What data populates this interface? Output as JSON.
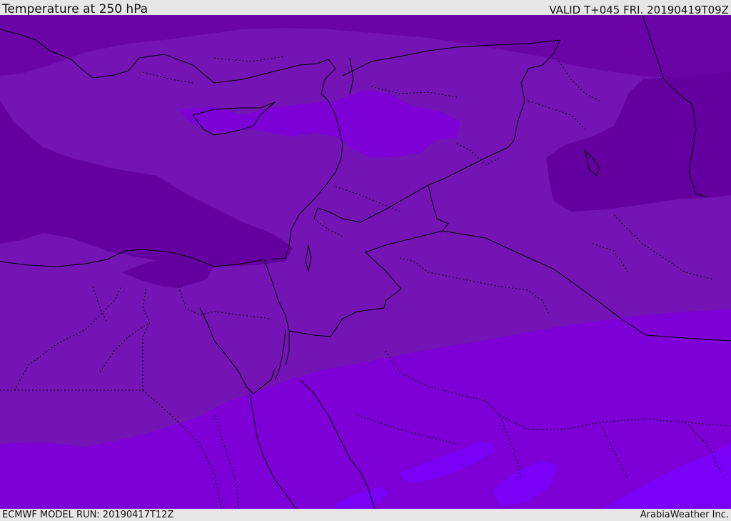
{
  "header": {
    "title": "Temperature at 250 hPa",
    "valid_time": "VALID T+045 FRI. 20190419T09Z"
  },
  "footer": {
    "model_run": "ECMWF MODEL RUN: 20190417T12Z",
    "credit": "ArabiaWeather Inc."
  },
  "map": {
    "fill_colors": {
      "coldest": "#6400a0",
      "cold": "#7414b4",
      "mid": "#7d00d7",
      "warm": "#8000e6",
      "warmest": "#7a00f6"
    },
    "border_color": "#000000",
    "region": "Eastern Mediterranean and Middle East"
  }
}
